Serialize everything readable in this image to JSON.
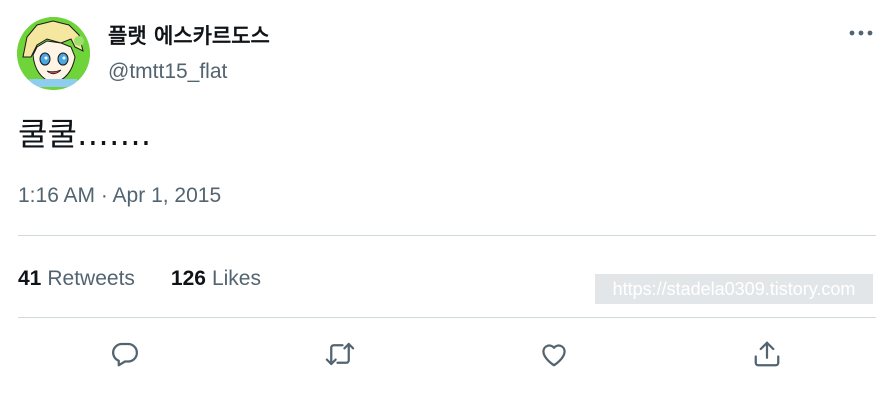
{
  "tweet": {
    "display_name": "플랫 에스카르도스",
    "handle": "@tmtt15_flat",
    "text": "쿨쿨…….",
    "timestamp": "1:16 AM · Apr 1, 2015"
  },
  "stats": {
    "retweets_count": "41",
    "retweets_label": "Retweets",
    "likes_count": "126",
    "likes_label": "Likes"
  },
  "watermark": "https://stadela0309.tistory.com",
  "icons": {
    "more": "more-horizontal-icon",
    "reply": "reply-icon",
    "retweet": "retweet-icon",
    "like": "like-icon",
    "share": "share-icon"
  },
  "colors": {
    "text_primary": "#0f1419",
    "text_secondary": "#536471",
    "divider": "#cfd9de",
    "icon": "#536471"
  }
}
